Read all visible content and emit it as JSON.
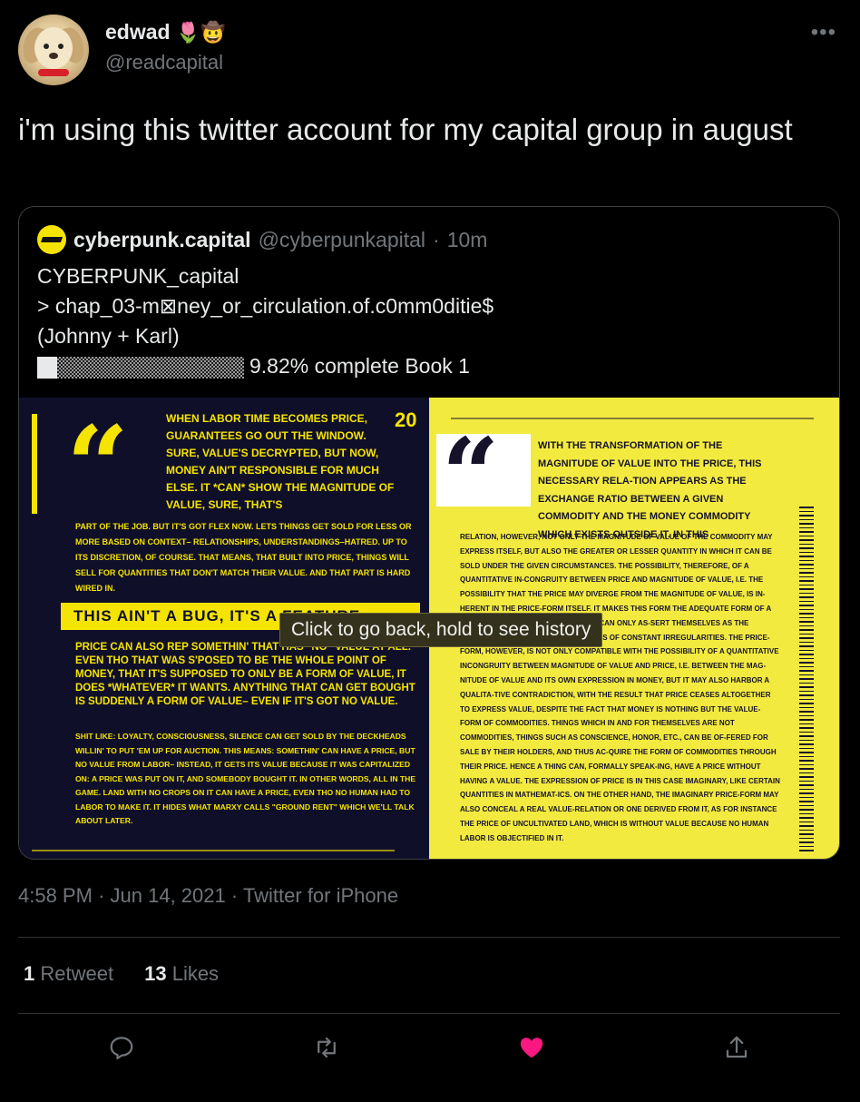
{
  "author": {
    "name": "edwad",
    "emojis": "🌷🤠",
    "handle": "@readcapital",
    "more_label": "•••"
  },
  "tweet": {
    "text": "i'm using this twitter account for my capital group in august"
  },
  "quoted": {
    "name": "cyberpunk.capital",
    "handle": "@cyberpunkapital",
    "separator": "·",
    "time": "10m",
    "body_line1": "CYBERPUNK_capital",
    "body_line2": "> chap_03-m⊠ney_or_circulation.of.c0mm0ditie$",
    "body_line3": "(Johnny + Karl)",
    "progress_text": "9.82% complete Book 1",
    "progress_fraction": 0.0982,
    "media": {
      "left_page": {
        "page_number": "20",
        "lead": "When labor time becomes price, guarantees go out the window. Sure, value's decrypted, but now, money ain't responsible for much else. It *can* show the magnitude of value, sure, that's",
        "para1": "part of the job. But it's got flex now. Lets things get sold for less or more based on context– relationships, understandings–hatred. Up to its discretion, of course. That means, that built into price, things will sell for quantities that don't match their value. And that part is hard wired in.",
        "banner": "THIS AIN'T A BUG, IT'S A FEATURE",
        "para2": "Price can also rep somethin' that has \"no\" value at all. Even tho that was s'posed to be the whole point of money, that it's supposed to only be a form of value, it does *whatever* it wants. Anything that can get bought is suddenly a form of value– even if it's got no value.",
        "para3": "Shit like: loyalty, consciousness, silence can get sold by the deckheads willin' to put 'em up for auction. This means: somethin' can have a price, but no value from labor– instead, it gets its value because it was capitalized on: a price was put on it, and somebody bought it. In other words, all in the game. Land with no crops on it can have a price, even tho no human had to labor to make it. It hides what Marxy calls \"ground rent\" which we'll talk about later."
      },
      "right_page": {
        "lead": "With the transformation of the magnitude of value into the price, this necessary rela-tion appears as the exchange ratio between a given commodity and the money commodity which exists outside it. In this",
        "body": "relation, however, not only the magnitude of value of the commodity may express itself, but also the greater or lesser quantity in which it can be sold under the given circumstances. The possibility, therefore, of a quantitative in-congruity between price and magnitude of value, i.e. the possibility that the price may diverge from the magnitude of value, is in-herent in the price-form itself. It makes this form the adequate form of a mode of production whose laws can only as-sert themselves as the blindly operating law of averages of constant irregularities. The price-form, however, is not only compatible with the possibility of a quantitative incongruity between magnitude of value and price, i.e. between the mag-nitude of value and its own expression in money, but it may also harbor a qualita-tive contradiction, with the result that price ceases altogether to express value, despite the fact that money is nothing but the value-form of commodities. Things which in and for themselves are not commodities, things such as conscience, honor, etc., can be of-fered for sale by their holders, and thus ac-quire the form of commodities through their price. Hence a thing can, formally speak-ing, have a price without having a value. The expression of price is in this case imaginary, like certain quantities in mathemat-ics. On the other hand, the imaginary price-form may also conceal a real value-relation or one derived from it, as for instance the price of uncultivated land, which is without value because no human labor is objectified in it."
      }
    }
  },
  "tooltip": {
    "text": "Click to go back, hold to see history"
  },
  "meta": {
    "time": "4:58 PM",
    "sep1": "·",
    "date": "Jun 14, 2021",
    "sep2": "·",
    "source": "Twitter for iPhone"
  },
  "stats": {
    "retweets_count": "1",
    "retweets_label": "Retweet",
    "likes_count": "13",
    "likes_label": "Likes"
  },
  "actions": {
    "reply_icon": "reply-icon",
    "retweet_icon": "retweet-icon",
    "like_icon": "heart-icon",
    "like_color": "#f91880",
    "share_icon": "share-icon"
  }
}
